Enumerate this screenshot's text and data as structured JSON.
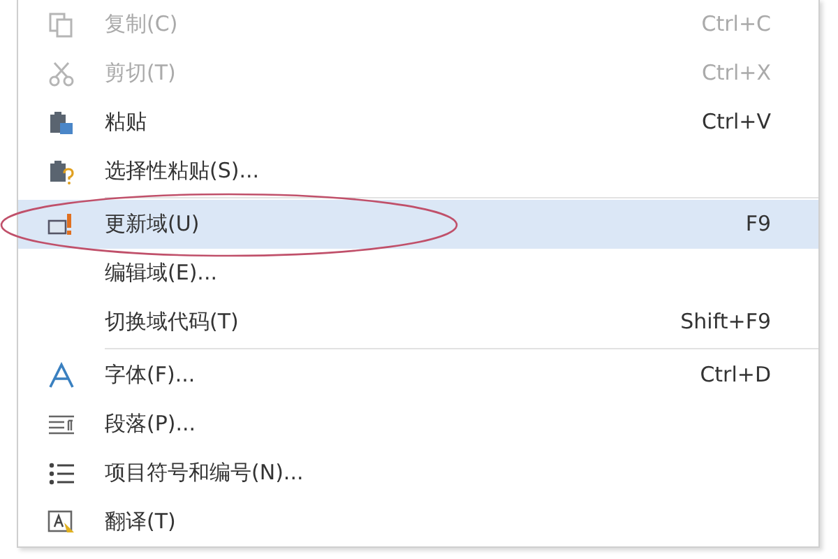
{
  "menu": {
    "items": [
      {
        "kind": "item",
        "label": "复制(C)",
        "shortcut": "Ctrl+C",
        "disabled": true,
        "selected": false
      },
      {
        "kind": "item",
        "label": "剪切(T)",
        "shortcut": "Ctrl+X",
        "disabled": true,
        "selected": false
      },
      {
        "kind": "item",
        "label": "粘贴",
        "shortcut": "Ctrl+V",
        "disabled": false,
        "selected": false
      },
      {
        "kind": "item",
        "label": "选择性粘贴(S)...",
        "disabled": false,
        "selected": false
      },
      {
        "kind": "separator"
      },
      {
        "kind": "item",
        "label": "更新域(U)",
        "shortcut": "F9",
        "disabled": false,
        "selected": true,
        "circled": true
      },
      {
        "kind": "item",
        "label": "编辑域(E)...",
        "disabled": false,
        "selected": false
      },
      {
        "kind": "item",
        "label": "切换域代码(T)",
        "shortcut": "Shift+F9",
        "disabled": false,
        "selected": false
      },
      {
        "kind": "separator"
      },
      {
        "kind": "item",
        "label": "字体(F)...",
        "shortcut": "Ctrl+D",
        "disabled": false,
        "selected": false
      },
      {
        "kind": "item",
        "label": "段落(P)...",
        "disabled": false,
        "selected": false
      },
      {
        "kind": "item",
        "label": "项目符号和编号(N)...",
        "disabled": false,
        "selected": false
      },
      {
        "kind": "item",
        "label": "翻译(T)",
        "disabled": false,
        "selected": false
      }
    ]
  }
}
